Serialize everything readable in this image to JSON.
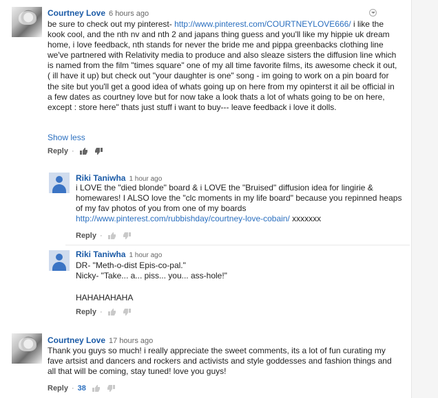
{
  "comments": [
    {
      "author": "Courtney Love",
      "time": "6 hours ago",
      "text_before_link": "be sure to check out my pinterest- ",
      "link": "http://www.pinterest.com/COURTNEYLOVE666/",
      "text_after_link": " i like the kook cool, and the nth nv and nth 2 and japans thing guess and you'll like my hippie uk dream home, i love feedback, nth stands for never the bride me and pippa greenbacks clothing line we've partnered with Relativity media to produce and also sleaze sisters the diffusion line which is named from the film \"times square\" one of my all time favorite films, its awesome check it out, ( ill have it up) but check out \"your daughter is one\" song - im going to work on a  pin board for the site but you'll get a good idea of whats going up on here from my opinterst it ail be official in a few dates as courtney love but for now take a look thats a lot of whats going to be on here, except : store here\" thats just stuff i want to buy--- leave feedback i love it dolls.",
      "show_less": "Show less",
      "reply_label": "Reply"
    },
    {
      "author": "Riki Taniwha",
      "time": "1 hour ago",
      "text": "i LOVE the \"died blonde\" board & i LOVE the \"Bruised\" diffusion idea for lingirie & homewares! I ALSO love the \"clc moments in my life board\" because you repinned heaps of my fav photos of you from one of my boards",
      "link": "http://www.pinterest.com/rubbishday/courtney-love-cobain/",
      "link_suffix": " xxxxxxx",
      "reply_label": "Reply"
    },
    {
      "author": "Riki Taniwha",
      "time": "1 hour ago",
      "line1": "DR- \"Meth-o-dist Epis-co-pal.\"",
      "line2": "Nicky- \"Take... a... piss... you... ass-hole!\"",
      "line3": "HAHAHAHAHA",
      "reply_label": "Reply"
    },
    {
      "author": "Courtney Love",
      "time": "17 hours ago",
      "text": "Thank you guys so much! i really appreciate the sweet comments, its a lot of fun curating my fave artsist and dancers and rockers and activists and style goddesses and fashion things and all that will be coming, stay tuned!  love you guys!",
      "reply_label": "Reply",
      "likes": "38"
    }
  ],
  "colors": {
    "author": "#1a5aa6",
    "link": "#2a6fbf"
  }
}
